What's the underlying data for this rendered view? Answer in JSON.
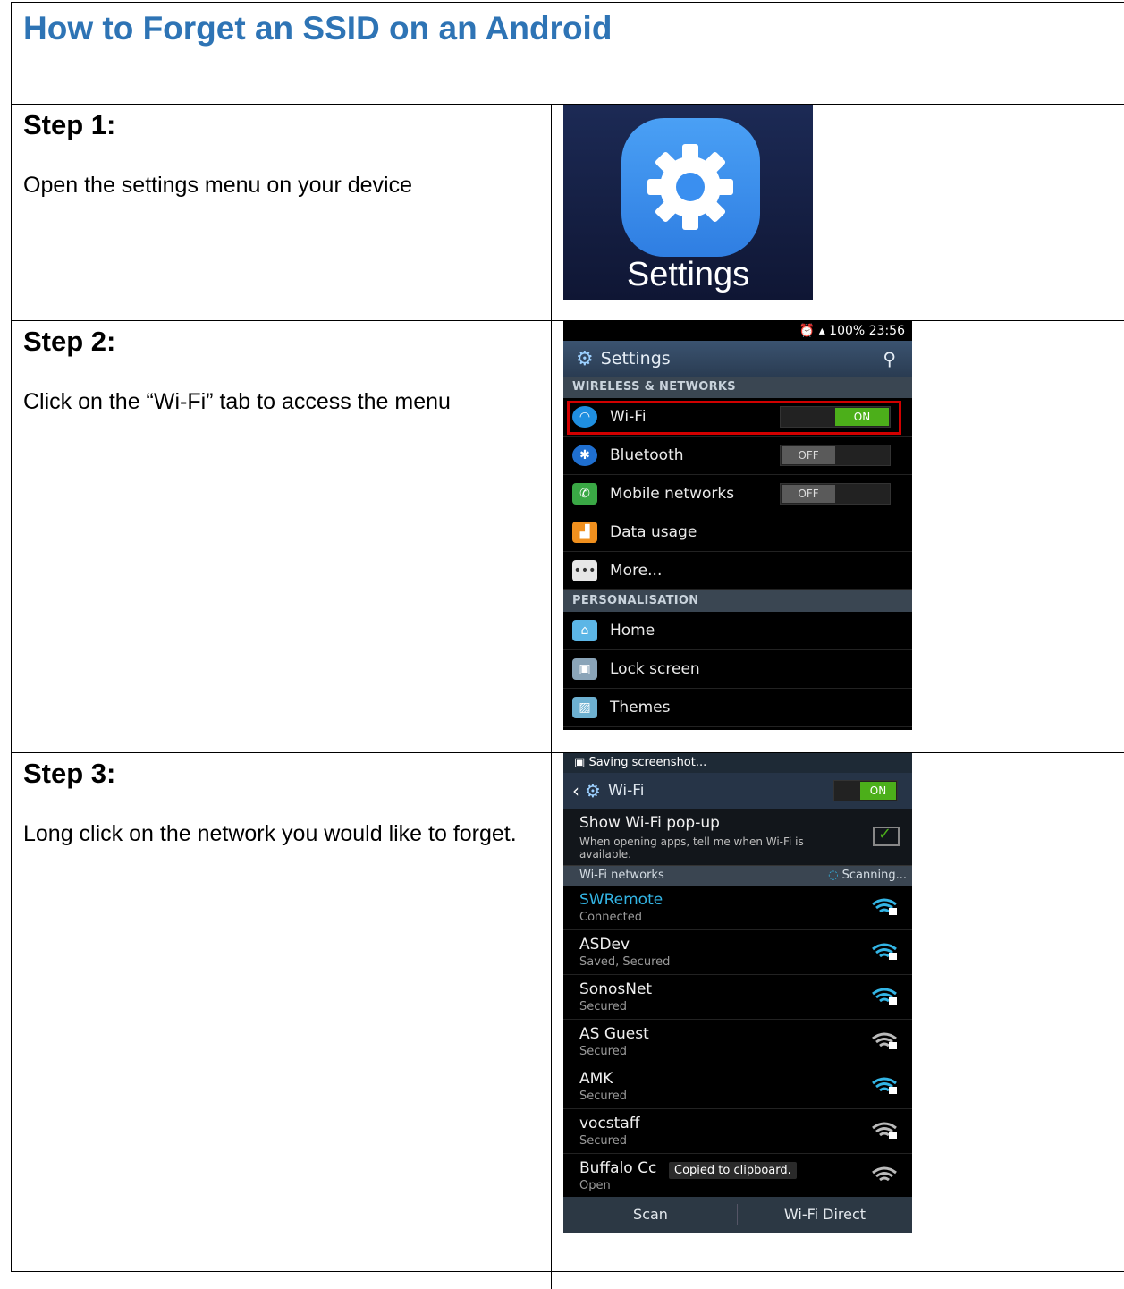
{
  "title": "How to Forget an SSID on an Android",
  "steps": [
    {
      "label": "Step 1:",
      "text": "Open the settings menu on your device"
    },
    {
      "label": "Step 2:",
      "text": "Click on the “Wi-Fi” tab to access the menu"
    },
    {
      "label": "Step 3:",
      "text": "Long click on the network you would like to forget."
    }
  ],
  "step1_image": {
    "label": "Settings"
  },
  "step2_screen": {
    "status": "100% 23:56",
    "header": "Settings",
    "section1": "WIRELESS & NETWORKS",
    "rows": [
      {
        "label": "Wi-Fi",
        "toggle": "ON"
      },
      {
        "label": "Bluetooth",
        "toggle": "OFF"
      },
      {
        "label": "Mobile networks",
        "toggle": "OFF"
      },
      {
        "label": "Data usage"
      },
      {
        "label": "More..."
      }
    ],
    "section2": "PERSONALISATION",
    "rows2": [
      {
        "label": "Home"
      },
      {
        "label": "Lock screen"
      },
      {
        "label": "Themes"
      }
    ]
  },
  "step3_screen": {
    "status": "Saving screenshot...",
    "header": "Wi-Fi",
    "toggle": "ON",
    "popup_title": "Show Wi-Fi pop-up",
    "popup_sub": "When opening apps, tell me when Wi-Fi is available.",
    "networks_head": "Wi-Fi networks",
    "scanning": "Scanning...",
    "networks": [
      {
        "name": "SWRemote",
        "status": "Connected"
      },
      {
        "name": "ASDev",
        "status": "Saved, Secured"
      },
      {
        "name": "SonosNet",
        "status": "Secured"
      },
      {
        "name": "AS Guest",
        "status": "Secured"
      },
      {
        "name": "AMK",
        "status": "Secured"
      },
      {
        "name": "vocstaff",
        "status": "Secured"
      },
      {
        "name": "Buffalo Cc",
        "status": "Open"
      }
    ],
    "toast": "Copied to clipboard.",
    "bottom": [
      "Scan",
      "Wi-Fi Direct"
    ]
  },
  "colors": {
    "title": "#2e74b5",
    "connected": "#33b5e5",
    "on": "#4caf1a"
  }
}
